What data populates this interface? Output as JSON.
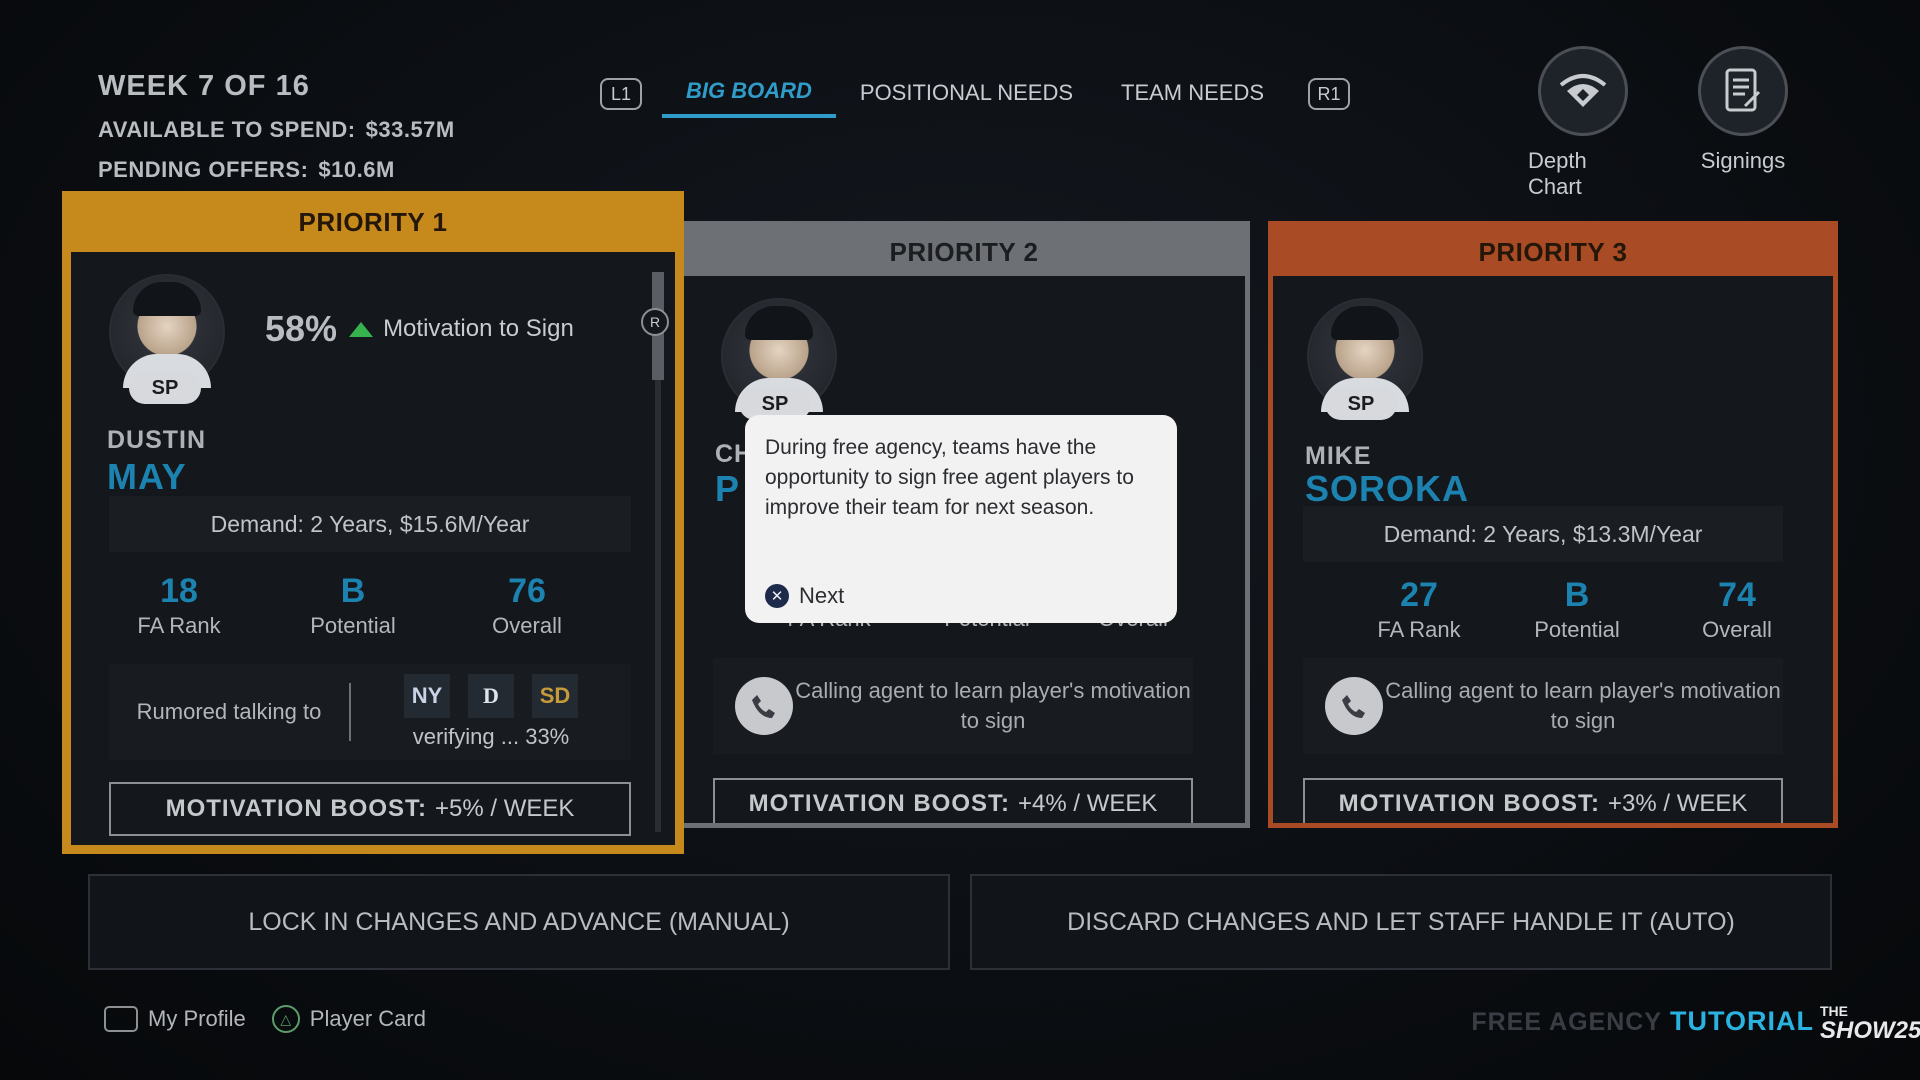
{
  "header": {
    "week": "WEEK 7 OF 16",
    "available_label": "AVAILABLE TO SPEND:",
    "available_value": "$33.57M",
    "pending_label": "PENDING OFFERS:",
    "pending_value": "$10.6M"
  },
  "tabs": {
    "left_button": "L1",
    "right_button": "R1",
    "items": [
      "BIG BOARD",
      "POSITIONAL NEEDS",
      "TEAM NEEDS"
    ],
    "active": "BIG BOARD"
  },
  "top_buttons": {
    "depth_chart": "Depth Chart",
    "signings": "Signings"
  },
  "cards": [
    {
      "priority": "PRIORITY 1",
      "position": "SP",
      "first_name": "DUSTIN",
      "last_name": "MAY",
      "motivation_pct": "58%",
      "motivation_label": "Motivation to Sign",
      "demand": "Demand: 2 Years, $15.6M/Year",
      "fa_rank": "18",
      "fa_rank_label": "FA Rank",
      "potential": "B",
      "potential_label": "Potential",
      "overall": "76",
      "overall_label": "Overall",
      "rumor_label": "Rumored talking to",
      "rumor_status": "verifying ... 33%",
      "boost_label": "MOTIVATION BOOST:",
      "boost_value": "+5% / WEEK",
      "scroll_button": "R"
    },
    {
      "priority": "PRIORITY 2",
      "position": "SP",
      "first_name": "CH",
      "last_name": "P",
      "fa_rank_label": "FA Rank",
      "potential_label": "Potential",
      "overall_label": "Overall",
      "calling": "Calling agent to learn player's motivation to sign",
      "boost_label": "MOTIVATION BOOST:",
      "boost_value": "+4% / WEEK"
    },
    {
      "priority": "PRIORITY 3",
      "position": "SP",
      "first_name": "MIKE",
      "last_name": "SOROKA",
      "demand": "Demand: 2 Years, $13.3M/Year",
      "fa_rank": "27",
      "fa_rank_label": "FA Rank",
      "potential": "B",
      "potential_label": "Potential",
      "overall": "74",
      "overall_label": "Overall",
      "calling": "Calling agent to learn player's motivation to sign",
      "boost_label": "MOTIVATION BOOST:",
      "boost_value": "+3% / WEEK"
    }
  ],
  "tooltip": {
    "message": "During free agency, teams have the opportunity to sign free agent players to improve their team for next season.",
    "next_label": "Next"
  },
  "actions": {
    "lock": "LOCK IN CHANGES AND ADVANCE (MANUAL)",
    "discard": "DISCARD CHANGES AND LET STAFF HANDLE IT (AUTO)"
  },
  "footer": {
    "my_profile": "My Profile",
    "player_card": "Player Card",
    "free_agency": "FREE AGENCY",
    "tutorial": "TUTORIAL",
    "brand_top": "THE",
    "brand_bottom": "SHOW25"
  },
  "colors": {
    "accent_blue": "#2f9cc9",
    "priority1": "#c58a1b",
    "priority2": "#6d7075",
    "priority3": "#a94c26"
  }
}
